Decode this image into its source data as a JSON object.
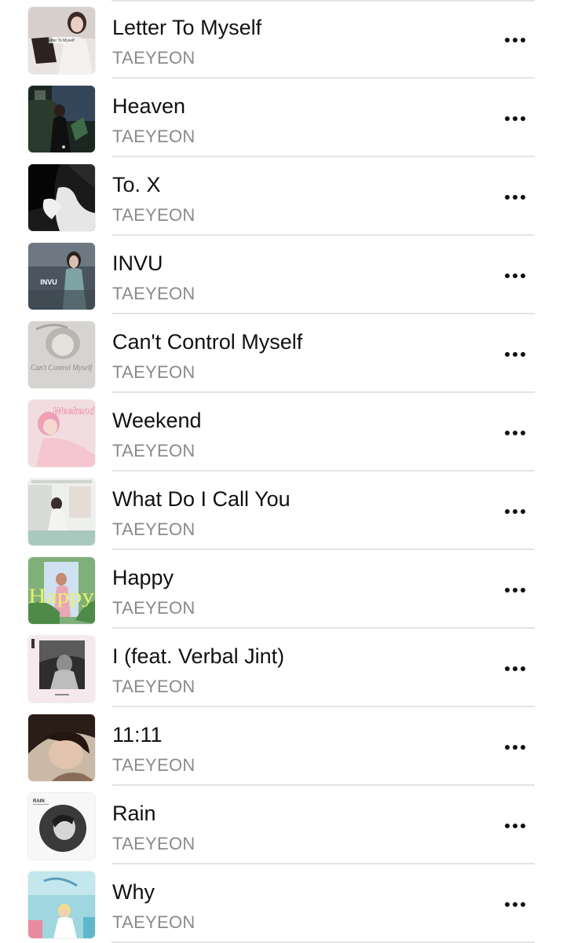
{
  "songs": [
    {
      "title": "Letter To Myself",
      "artist": "TAEYEON",
      "art_icon": "album-art-letter-to-myself",
      "art_text": "Letter To Myself"
    },
    {
      "title": "Heaven",
      "artist": "TAEYEON",
      "art_icon": "album-art-heaven"
    },
    {
      "title": "To. X",
      "artist": "TAEYEON",
      "art_icon": "album-art-to-x"
    },
    {
      "title": "INVU",
      "artist": "TAEYEON",
      "art_icon": "album-art-invu",
      "art_text": "INVU"
    },
    {
      "title": "Can't Control Myself",
      "artist": "TAEYEON",
      "art_icon": "album-art-cant-control-myself",
      "art_text": "Can't Control Myself"
    },
    {
      "title": "Weekend",
      "artist": "TAEYEON",
      "art_icon": "album-art-weekend",
      "art_text": "Weekend"
    },
    {
      "title": "What Do I Call You",
      "artist": "TAEYEON",
      "art_icon": "album-art-what-do-i-call-you"
    },
    {
      "title": "Happy",
      "artist": "TAEYEON",
      "art_icon": "album-art-happy",
      "art_text": "Happy"
    },
    {
      "title": "I (feat. Verbal Jint)",
      "artist": "TAEYEON",
      "art_icon": "album-art-i"
    },
    {
      "title": "11:11",
      "artist": "TAEYEON",
      "art_icon": "album-art-11-11"
    },
    {
      "title": "Rain",
      "artist": "TAEYEON",
      "art_icon": "album-art-rain",
      "art_text": "RAIN"
    },
    {
      "title": "Why",
      "artist": "TAEYEON",
      "art_icon": "album-art-why"
    }
  ],
  "more_icon": "ellipsis-icon",
  "colors": {
    "title": "#111111",
    "artist": "#8a8a8e",
    "divider": "#e4e4e6"
  }
}
